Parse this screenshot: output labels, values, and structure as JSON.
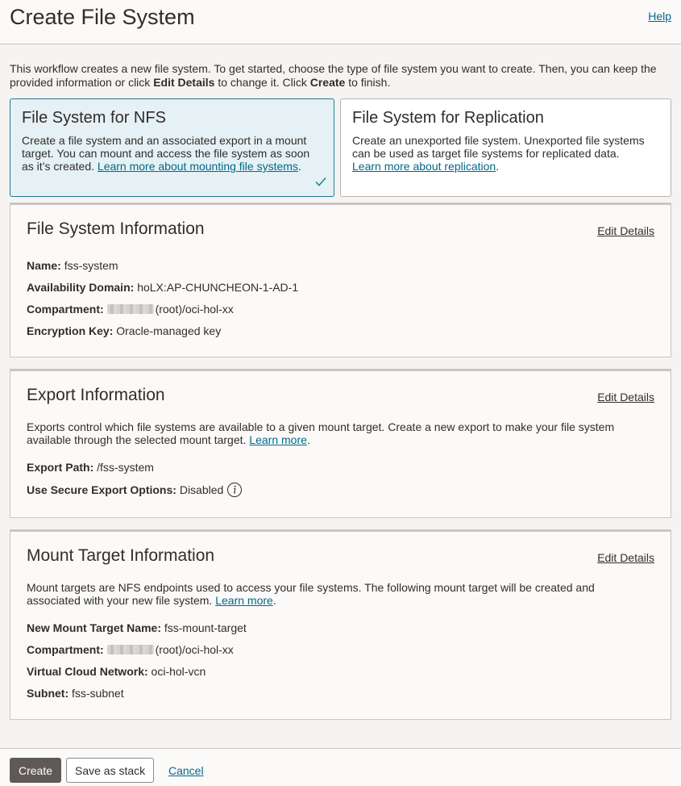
{
  "header": {
    "title": "Create File System",
    "help_label": "Help"
  },
  "intro": {
    "text_1": "This workflow creates a new file system. To get started, choose the type of file system you want to create. Then, you can keep the provided information or click ",
    "bold_1": "Edit Details",
    "text_2": " to change it. Click ",
    "bold_2": "Create",
    "text_3": " to finish."
  },
  "types": {
    "nfs": {
      "title": "File System for NFS",
      "desc": "Create a file system and an associated export in a mount target. You can mount and access the file system as soon as it’s created. ",
      "link": "Learn more about mounting file systems",
      "suffix": ".",
      "selected": true
    },
    "replication": {
      "title": "File System for Replication",
      "desc": "Create an unexported file system. Unexported file systems can be used as target file systems for replicated data.",
      "link": "Learn more about replication",
      "suffix": "."
    }
  },
  "file_system_info": {
    "title": "File System Information",
    "edit_label": "Edit Details",
    "name_label": "Name:",
    "name_value": "fss-system",
    "ad_label": "Availability Domain:",
    "ad_value": "hoLX:AP-CHUNCHEON-1-AD-1",
    "compartment_label": "Compartment:",
    "compartment_value": "(root)/oci-hol-xx",
    "encryption_label": "Encryption Key:",
    "encryption_value": "Oracle-managed key"
  },
  "export_info": {
    "title": "Export Information",
    "edit_label": "Edit Details",
    "desc": "Exports control which file systems are available to a given mount target. Create a new export to make your file system available through the selected mount target. ",
    "learn_more": "Learn more",
    "suffix": ".",
    "path_label": "Export Path:",
    "path_value": "/fss-system",
    "secure_label": "Use Secure Export Options:",
    "secure_value": "Disabled"
  },
  "mount_target_info": {
    "title": "Mount Target Information",
    "edit_label": "Edit Details",
    "desc": "Mount targets are NFS endpoints used to access your file systems. The following mount target will be created and associated with your new file system. ",
    "learn_more": "Learn more",
    "suffix": ".",
    "name_label": "New Mount Target Name:",
    "name_value": "fss-mount-target",
    "compartment_label": "Compartment:",
    "compartment_value": "(root)/oci-hol-xx",
    "vcn_label": "Virtual Cloud Network:",
    "vcn_value": "oci-hol-vcn",
    "subnet_label": "Subnet:",
    "subnet_value": "fss-subnet"
  },
  "footer": {
    "create_label": "Create",
    "stack_label": "Save as stack",
    "cancel_label": "Cancel"
  },
  "icons": {
    "check": "check-icon",
    "info": "info-icon"
  },
  "colors": {
    "accent_link": "#00688c",
    "selected_bg": "#e5f1f4",
    "primary_button": "#5f5a56"
  }
}
